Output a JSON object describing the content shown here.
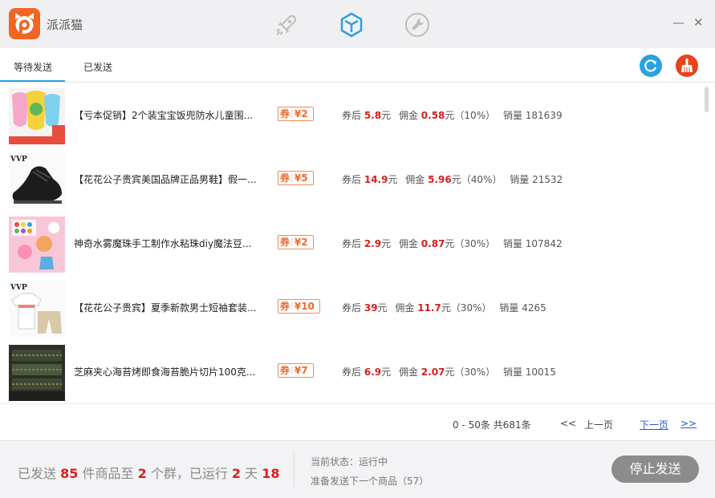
{
  "app": {
    "name": "派派猫",
    "colors": {
      "brand": "#f26522",
      "accent": "#2aa1e2",
      "highlight": "#d81e1e"
    }
  },
  "nav": [
    {
      "icon": "rocket-icon",
      "active": false
    },
    {
      "icon": "cube-icon",
      "active": true
    },
    {
      "icon": "wrench-icon",
      "active": false
    }
  ],
  "window": {
    "minimize": "—",
    "close": "✕"
  },
  "tabs": [
    {
      "label": "等待发送",
      "active": true
    },
    {
      "label": "已发送",
      "active": false
    }
  ],
  "toolbar": {
    "refresh_icon": "refresh-icon",
    "clean_icon": "broom-icon"
  },
  "labels": {
    "after_coupon": "券后",
    "yuan": "元",
    "commission": "佣金",
    "sales": "销量",
    "coupon_prefix": "券",
    "currency": "¥"
  },
  "products": [
    {
      "title": "【亏本促销】2个装宝宝饭兜防水儿童围...",
      "coupon": "2",
      "price": "5.8",
      "commission": "0.58",
      "rate": "（10%）",
      "sales": "181639",
      "thumb": "bibs"
    },
    {
      "title": "【花花公子贵宾美国品牌正品男鞋】假一...",
      "coupon": "5",
      "price": "14.9",
      "commission": "5.96",
      "rate": "（40%）",
      "sales": "21532",
      "thumb": "shoe"
    },
    {
      "title": "神奇水雾魔珠手工制作水粘珠diy魔法豆...",
      "coupon": "2",
      "price": "2.9",
      "commission": "0.87",
      "rate": "（30%）",
      "sales": "107842",
      "thumb": "beads"
    },
    {
      "title": "【花花公子贵宾】夏季新款男士短袖套装...",
      "coupon": "10",
      "price": "39",
      "commission": "11.7",
      "rate": "（30%）",
      "sales": "4265",
      "thumb": "shirt"
    },
    {
      "title": "芝麻夹心海苔烤即食海苔脆片切片100克...",
      "coupon": "7",
      "price": "6.9",
      "commission": "2.07",
      "rate": "（30%）",
      "sales": "10015",
      "thumb": "seaweed"
    }
  ],
  "pager": {
    "range": "0 - 50条 共681条",
    "first": "<<",
    "prev": "上一页",
    "next": "下一页",
    "last": ">>"
  },
  "footer": {
    "sent_prefix": "已发送",
    "sent_count": "85",
    "sent_mid": "件商品至",
    "group_count": "2",
    "group_suffix": "个群，已运行",
    "days": "2",
    "days_unit": "天",
    "hours": "18",
    "status_line": "当前状态：运行中",
    "next_line": "准备发送下一个商品（57）",
    "stop_label": "停止发送"
  }
}
